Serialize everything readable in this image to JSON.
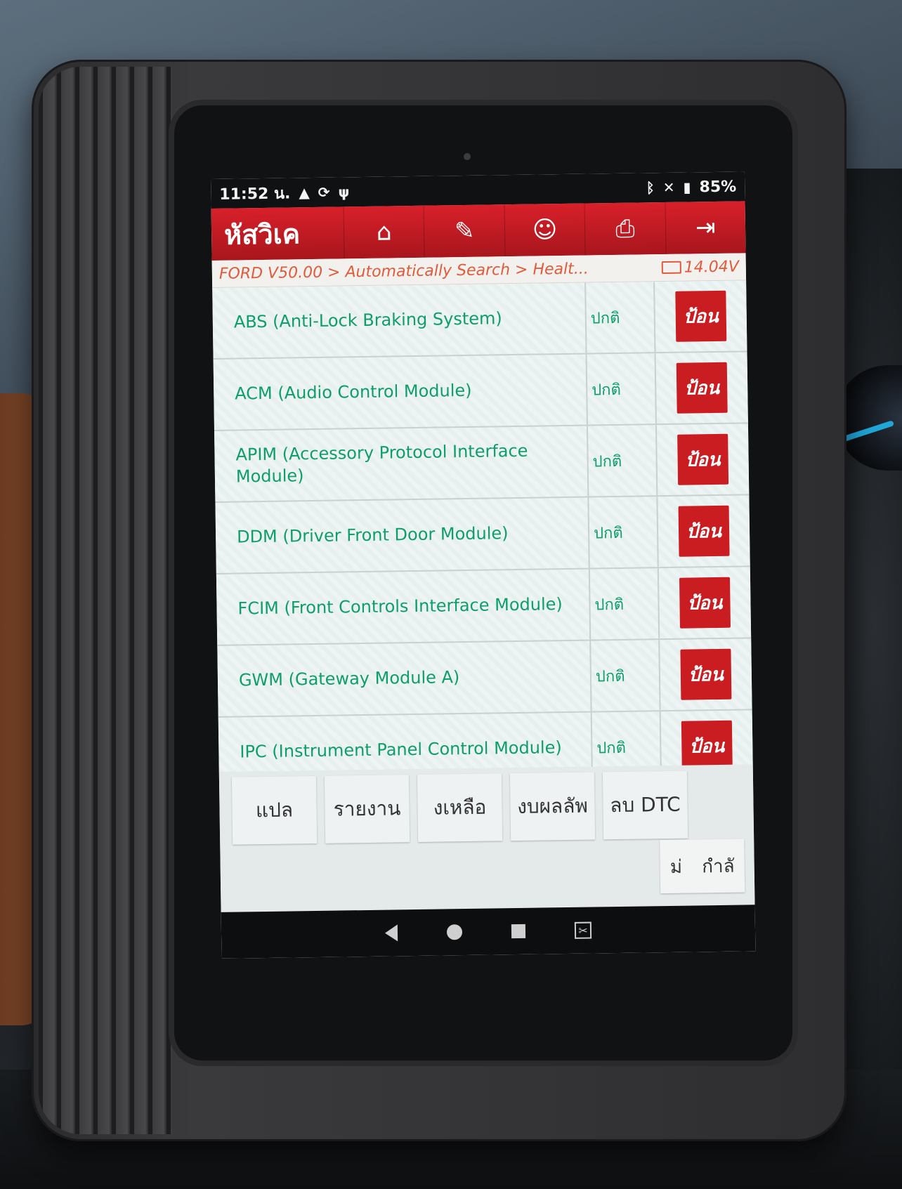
{
  "status_bar": {
    "time": "11:52 น.",
    "battery": "85%",
    "icons": [
      "warning-icon",
      "sync-icon",
      "usb-icon",
      "bluetooth-icon",
      "mute-icon",
      "battery-icon"
    ]
  },
  "toolbar": {
    "title": "หัสวิเค",
    "buttons": [
      {
        "icon": "home-icon",
        "glyph": "⌂"
      },
      {
        "icon": "edit-icon",
        "glyph": "✎"
      },
      {
        "icon": "user-icon",
        "glyph": "☺"
      },
      {
        "icon": "print-icon",
        "glyph": "⎙"
      },
      {
        "icon": "exit-icon",
        "glyph": "⇥"
      }
    ]
  },
  "breadcrumb": {
    "path": "FORD V50.00 > Automatically Search > Healt...",
    "voltage": "14.04V"
  },
  "modules": [
    {
      "name": "ABS (Anti-Lock Braking System)",
      "status": "ปกติ",
      "action": "ป้อน"
    },
    {
      "name": "ACM (Audio Control Module)",
      "status": "ปกติ",
      "action": "ป้อน"
    },
    {
      "name": "APIM (Accessory Protocol Interface Module)",
      "status": "ปกติ",
      "action": "ป้อน"
    },
    {
      "name": "DDM (Driver Front Door Module)",
      "status": "ปกติ",
      "action": "ป้อน"
    },
    {
      "name": "FCIM (Front Controls Interface Module)",
      "status": "ปกติ",
      "action": "ป้อน"
    },
    {
      "name": "GWM (Gateway Module A)",
      "status": "ปกติ",
      "action": "ป้อน"
    },
    {
      "name": "IPC (Instrument Panel Control Module)",
      "status": "ปกติ",
      "action": "ป้อน"
    }
  ],
  "bottom_buttons": {
    "translate": "แปล",
    "report": "รายงาน",
    "remaining": "งเหลือ",
    "results": "งบผลลัพ",
    "clear_dtc": "ลบ DTC",
    "small_left": "ม่",
    "small_right": "กำลั"
  }
}
